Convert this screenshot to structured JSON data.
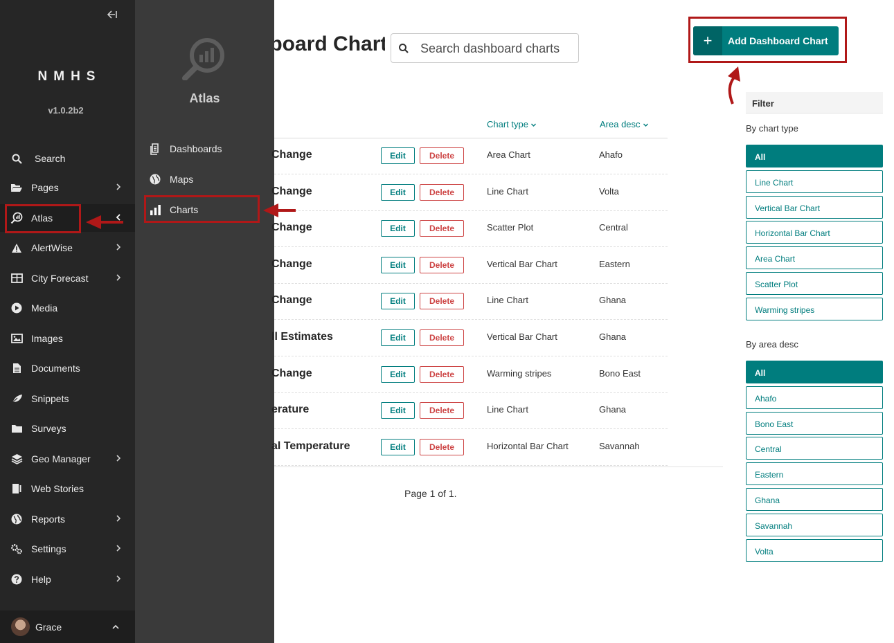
{
  "sidebar": {
    "brand": "NMHS",
    "version": "v1.0.2b2",
    "items": [
      {
        "label": "Search",
        "icon": "search-icon"
      },
      {
        "label": "Pages",
        "icon": "folder-open-icon"
      },
      {
        "label": "Atlas",
        "icon": "atlas-icon"
      },
      {
        "label": "AlertWise",
        "icon": "warning-icon"
      },
      {
        "label": "City Forecast",
        "icon": "table-icon"
      },
      {
        "label": "Media",
        "icon": "play-icon"
      },
      {
        "label": "Images",
        "icon": "image-icon"
      },
      {
        "label": "Documents",
        "icon": "document-icon"
      },
      {
        "label": "Snippets",
        "icon": "snippet-icon"
      },
      {
        "label": "Surveys",
        "icon": "folder-icon"
      },
      {
        "label": "Geo Manager",
        "icon": "layers-icon"
      },
      {
        "label": "Web Stories",
        "icon": "web-stories-icon"
      },
      {
        "label": "Reports",
        "icon": "globe-icon"
      },
      {
        "label": "Settings",
        "icon": "cogs-icon"
      },
      {
        "label": "Help",
        "icon": "help-icon"
      }
    ],
    "user": {
      "name": "Grace"
    }
  },
  "submenu": {
    "title": "Atlas",
    "items": [
      {
        "label": "Dashboards",
        "icon": "dashboards-icon"
      },
      {
        "label": "Maps",
        "icon": "globe-icon"
      },
      {
        "label": "Charts",
        "icon": "bar-chart-icon"
      }
    ]
  },
  "main": {
    "title": "Dashboard Charts",
    "search_placeholder": "Search dashboard charts",
    "add_button": "Add Dashboard Chart",
    "columns": {
      "chart_type": "Chart type",
      "area_desc": "Area desc"
    },
    "row_actions": {
      "edit": "Edit",
      "delete": "Delete"
    },
    "rows": [
      {
        "title": "Change",
        "chart_type": "Area Chart",
        "area_desc": "Ahafo"
      },
      {
        "title": "Change",
        "chart_type": "Line Chart",
        "area_desc": "Volta"
      },
      {
        "title": "Change",
        "chart_type": "Scatter Plot",
        "area_desc": "Central"
      },
      {
        "title": "Change",
        "chart_type": "Vertical Bar Chart",
        "area_desc": "Eastern"
      },
      {
        "title": "Change",
        "chart_type": "Line Chart",
        "area_desc": "Ghana"
      },
      {
        "title": "ll Estimates",
        "chart_type": "Vertical Bar Chart",
        "area_desc": "Ghana"
      },
      {
        "title": "Change",
        "chart_type": "Warming stripes",
        "area_desc": "Bono East"
      },
      {
        "title": "erature",
        "chart_type": "Line Chart",
        "area_desc": "Ghana"
      },
      {
        "title": "al Temperature",
        "chart_type": "Horizontal Bar Chart",
        "area_desc": "Savannah"
      }
    ],
    "pagination": "Page 1 of 1."
  },
  "filter": {
    "heading": "Filter",
    "chart_type_label": "By chart type",
    "chart_types": [
      "All",
      "Line Chart",
      "Vertical Bar Chart",
      "Horizontal Bar Chart",
      "Area Chart",
      "Scatter Plot",
      "Warming stripes"
    ],
    "area_label": "By area desc",
    "areas": [
      "All",
      "Ahafo",
      "Bono East",
      "Central",
      "Eastern",
      "Ghana",
      "Savannah",
      "Volta"
    ],
    "selected_chart_type": "All",
    "selected_area": "All"
  },
  "colors": {
    "accent": "#007d7e",
    "danger": "#cd4444",
    "sidebar": "#262626",
    "submenu": "#3a3a3a",
    "annotation": "#b01818"
  }
}
